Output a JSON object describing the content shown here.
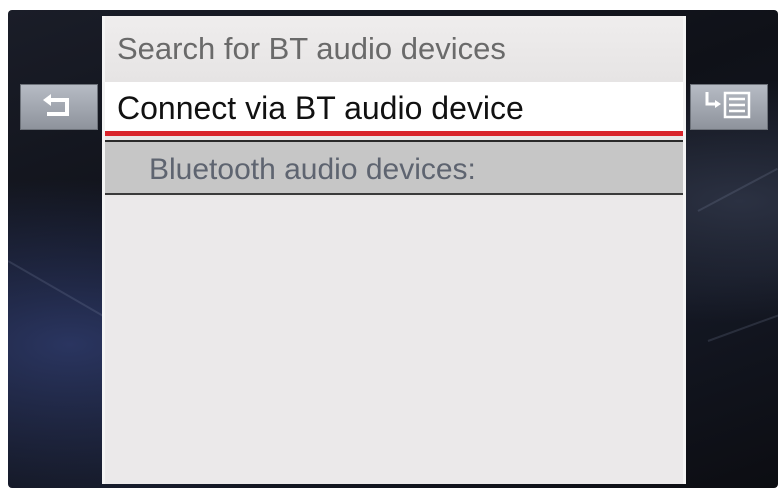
{
  "menu": {
    "items": [
      {
        "label": "Search for BT audio devices",
        "state": "normal"
      },
      {
        "label": "Connect via BT audio device",
        "state": "selected"
      }
    ],
    "section_header": "Bluetooth audio devices:",
    "devices": []
  },
  "buttons": {
    "back_icon": "back-arrow-icon",
    "submenu_icon": "submenu-list-icon"
  },
  "colors": {
    "selection_underline": "#d9242b",
    "panel_background": "#e9e7e7",
    "header_background": "#c6c6c6"
  }
}
